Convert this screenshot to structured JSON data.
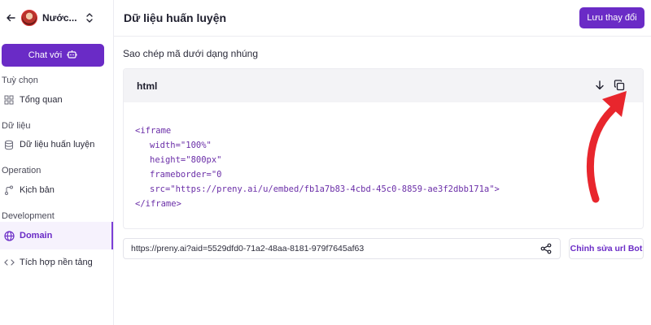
{
  "sidebar": {
    "bot_name": "Nước...",
    "chat_button_label": "Chat với",
    "sections": [
      {
        "title": "Tuỳ chọn",
        "items": [
          {
            "label": "Tổng quan",
            "icon": "grid-icon"
          }
        ]
      },
      {
        "title": "Dữ liệu",
        "items": [
          {
            "label": "Dữ liệu huấn luyện",
            "icon": "database-icon"
          }
        ]
      },
      {
        "title": "Operation",
        "items": [
          {
            "label": "Kịch bản",
            "icon": "branch-icon"
          }
        ]
      },
      {
        "title": "Development",
        "items": [
          {
            "label": "Domain",
            "icon": "globe-icon",
            "active": true
          },
          {
            "label": "Tích hợp nền tảng",
            "icon": "code-icon"
          }
        ]
      }
    ]
  },
  "header": {
    "title": "Dữ liệu huấn luyện",
    "save_label": "Lưu thay đổi"
  },
  "embed": {
    "caption": "Sao chép mã dưới dạng nhúng",
    "language": "html",
    "code_lines": [
      "<iframe",
      "width=\"100%\"",
      "height=\"800px\"",
      "frameborder=\"0",
      "src=\"https://preny.ai/u/embed/fb1a7b83-4cbd-45c0-8859-ae3f2dbb171a\">",
      "</iframe>"
    ]
  },
  "url_row": {
    "url": "https://preny.ai?aid=5529dfd0-71a2-48aa-8181-979f7645af63",
    "edit_label": "Chỉnh sửa url Bot"
  },
  "colors": {
    "accent": "#6a2bc6",
    "annotation": "#e8262d"
  }
}
